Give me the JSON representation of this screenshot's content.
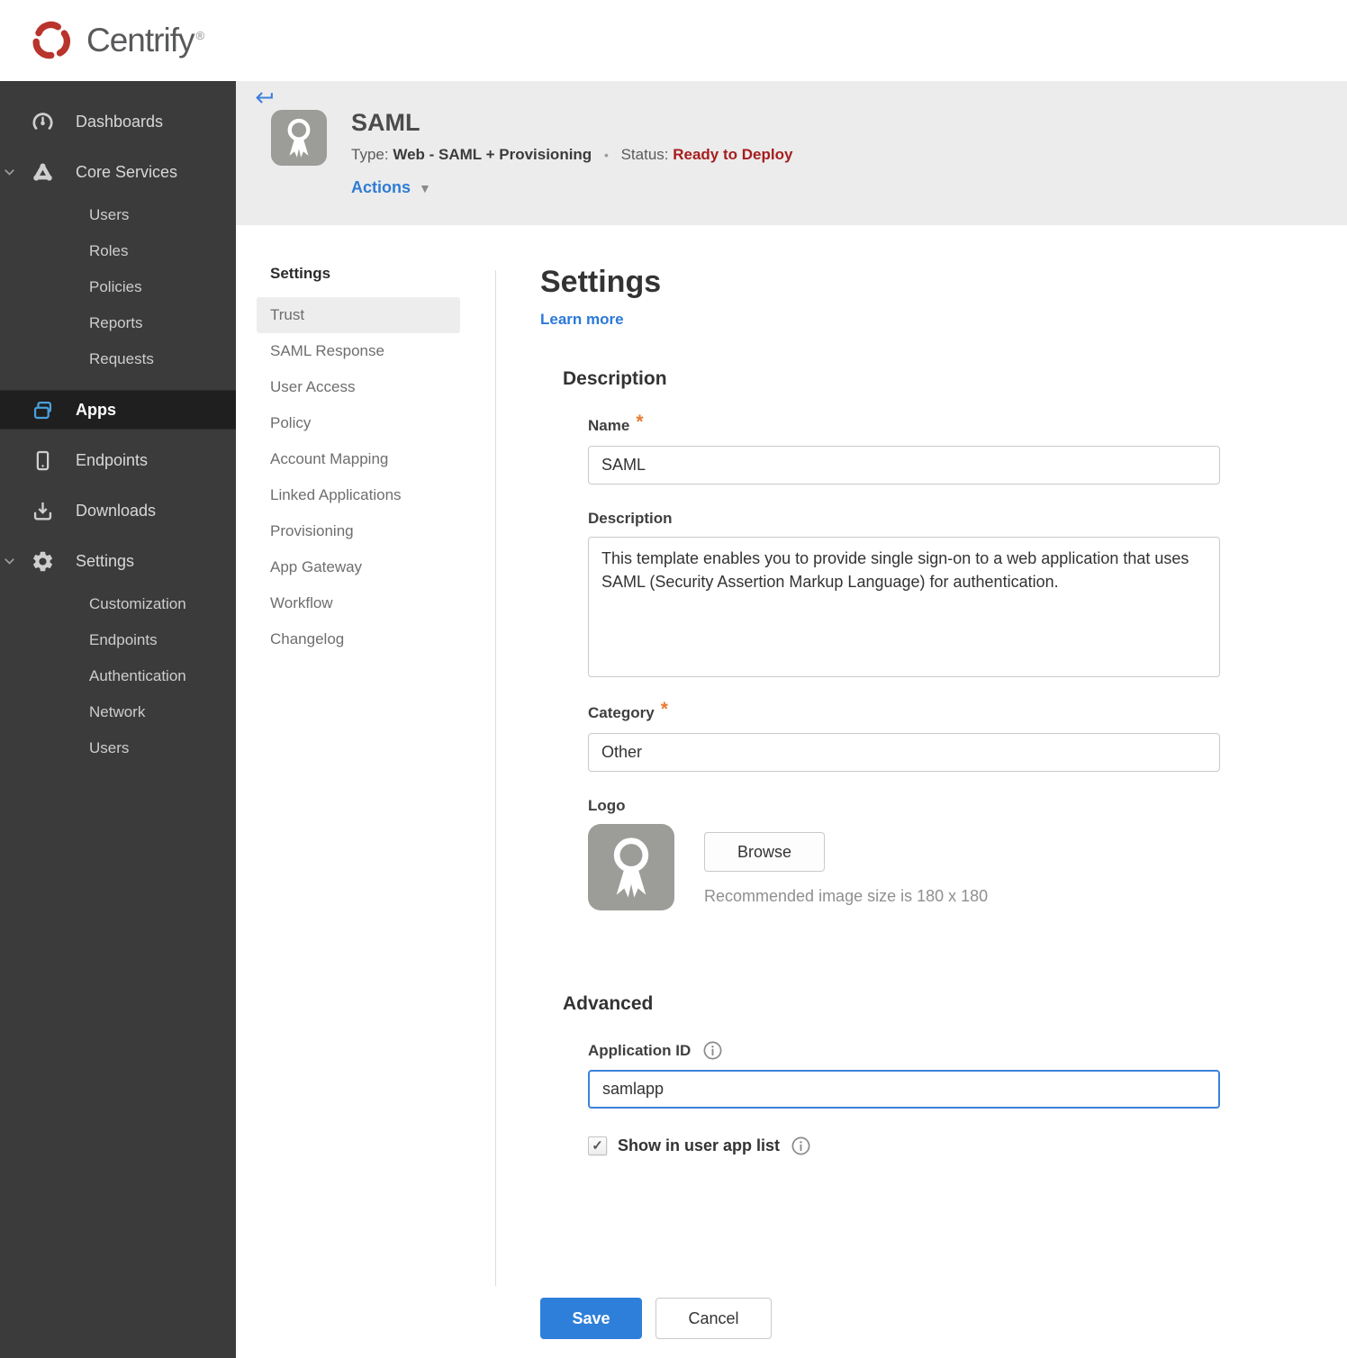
{
  "colors": {
    "accent_blue": "#2f7cd4",
    "link_blue": "#2b79d8",
    "save_button_blue": "#2e7fd9",
    "status_red": "#a61e1e",
    "brand_red": "#b8342c",
    "required_orange": "#e87a33",
    "sidebar_bg": "#3b3b3b",
    "sidebar_active_bg": "#1f1f1f",
    "header_band_bg": "#ececec",
    "app_icon_gray": "#9c9c98"
  },
  "glyphs": {
    "caret_down": "▼",
    "check": "✓",
    "separator": "•",
    "required": "*",
    "registered": "®"
  },
  "brand": {
    "name": "Centrify"
  },
  "sidebar": {
    "items": [
      {
        "label": "Dashboards"
      },
      {
        "label": "Core Services",
        "expanded": true
      },
      {
        "label": "Users"
      },
      {
        "label": "Roles"
      },
      {
        "label": "Policies"
      },
      {
        "label": "Reports"
      },
      {
        "label": "Requests"
      },
      {
        "label": "Apps",
        "active": true
      },
      {
        "label": "Endpoints"
      },
      {
        "label": "Downloads"
      },
      {
        "label": "Settings",
        "expanded": true
      },
      {
        "label": "Customization"
      },
      {
        "label": "Endpoints"
      },
      {
        "label": "Authentication"
      },
      {
        "label": "Network"
      },
      {
        "label": "Users"
      }
    ]
  },
  "app_header": {
    "title": "SAML",
    "type_label": "Type:",
    "type_value": "Web - SAML + Provisioning",
    "status_label": "Status:",
    "status_value": "Ready to Deploy",
    "actions_label": "Actions"
  },
  "subnav": {
    "heading": "Settings",
    "selected": "Trust",
    "items": [
      {
        "label": "Trust",
        "selected": true
      },
      {
        "label": "SAML Response"
      },
      {
        "label": "User Access"
      },
      {
        "label": "Policy"
      },
      {
        "label": "Account Mapping"
      },
      {
        "label": "Linked Applications"
      },
      {
        "label": "Provisioning"
      },
      {
        "label": "App Gateway"
      },
      {
        "label": "Workflow"
      },
      {
        "label": "Changelog"
      }
    ]
  },
  "form": {
    "heading": "Settings",
    "learn_more": "Learn more",
    "description": {
      "heading": "Description",
      "name_label": "Name",
      "name_value": "SAML",
      "desc_label": "Description",
      "desc_value": "This template enables you to provide single sign-on to a web application that uses SAML (Security Assertion Markup Language) for authentication.",
      "category_label": "Category",
      "category_value": "Other",
      "logo_label": "Logo",
      "browse_label": "Browse",
      "logo_hint": "Recommended image size is 180 x 180"
    },
    "advanced": {
      "heading": "Advanced",
      "app_id_label": "Application ID",
      "app_id_value": "samlapp",
      "show_label": "Show in user app list",
      "show_checked": true
    },
    "actions": {
      "save": "Save",
      "cancel": "Cancel"
    }
  }
}
